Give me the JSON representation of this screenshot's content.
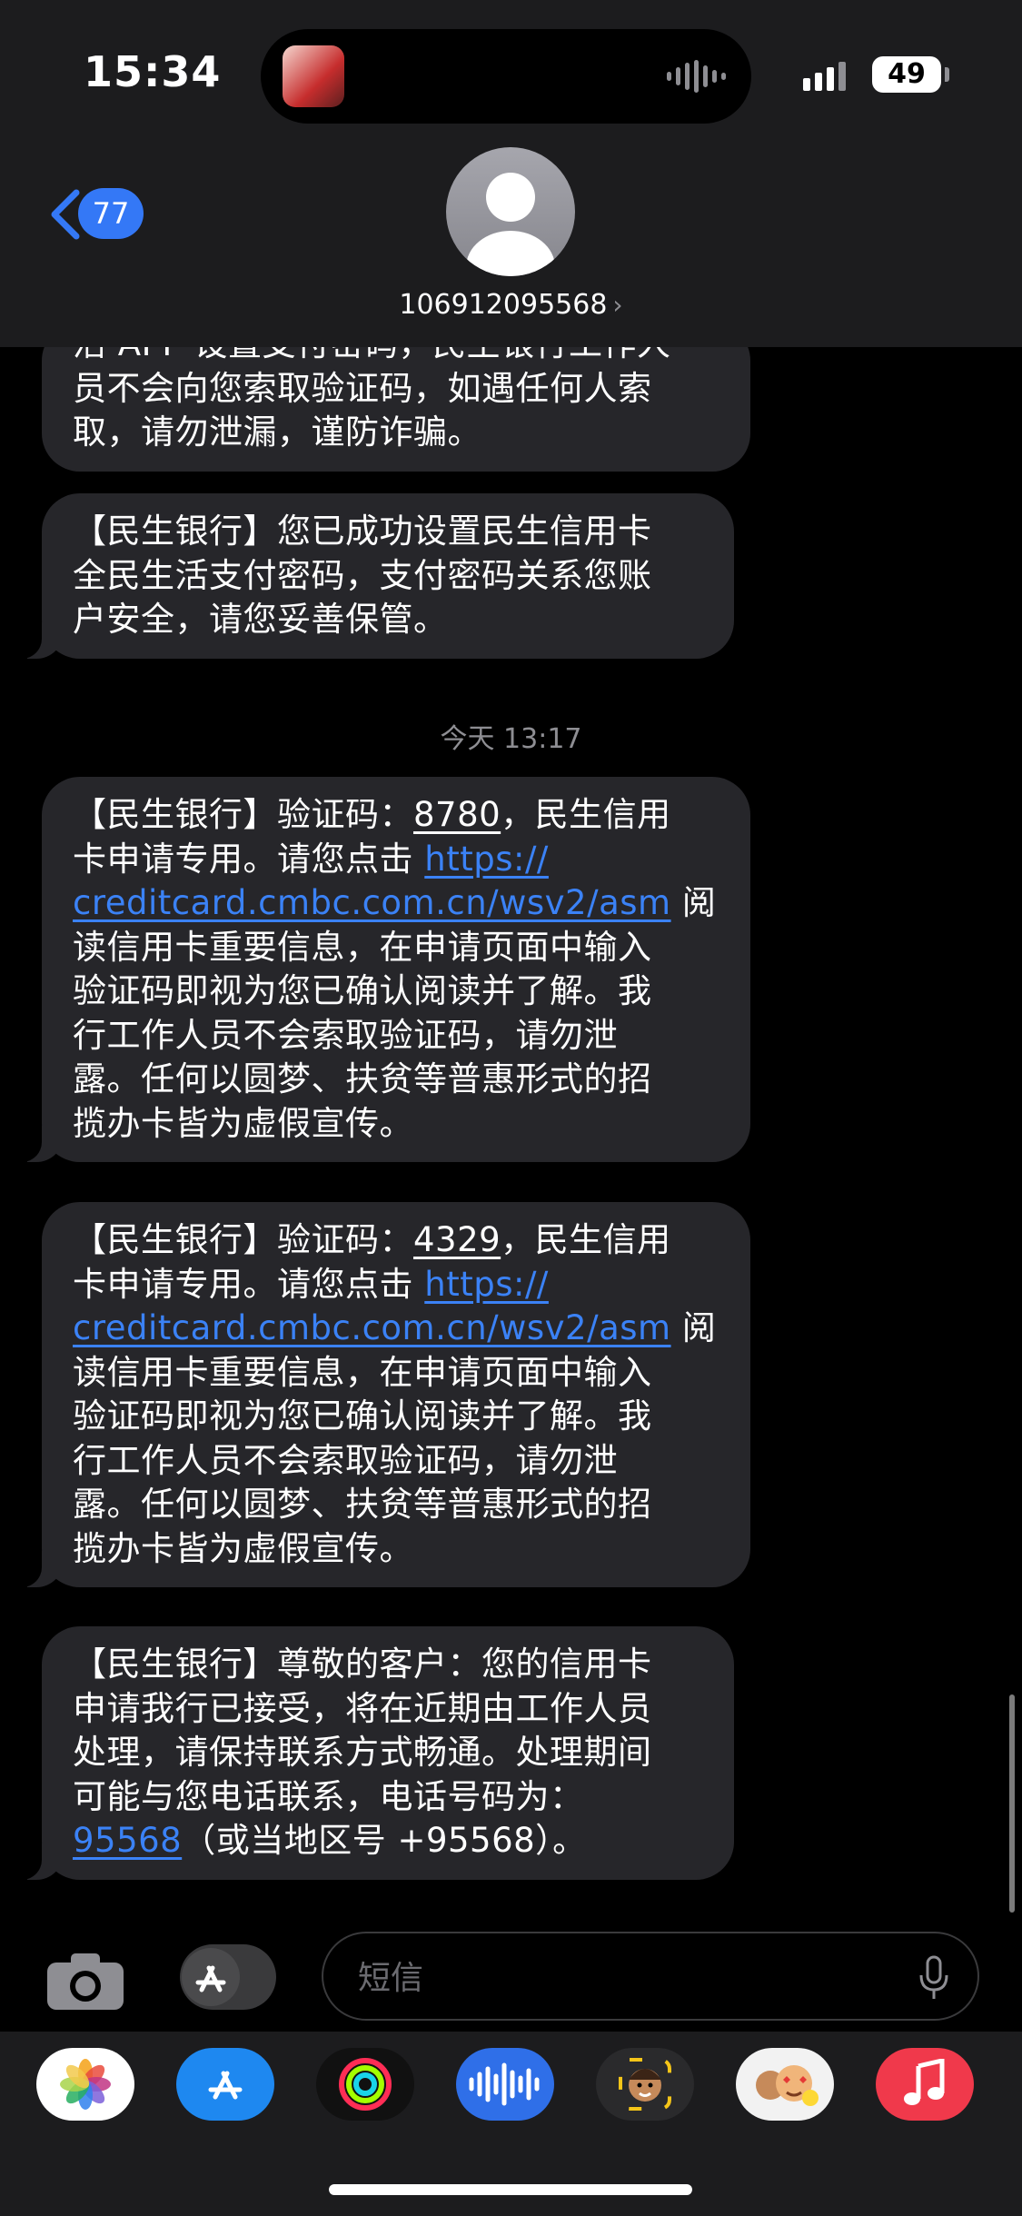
{
  "status": {
    "time": "15:34",
    "battery": "49"
  },
  "header": {
    "back_count": "77",
    "contact_number": "106912095568",
    "contact_chevron": "›"
  },
  "messages": {
    "partial": {
      "lines": [
        "活 APP 设置支付密码，民生银行工作人",
        "员不会向您索取验证码，如遇任何人索",
        "取，请勿泄漏，谨防诈骗。"
      ]
    },
    "m1": {
      "lines": [
        "【民生银行】您已成功设置民生信用卡",
        "全民生活支付密码，支付密码关系您账",
        "户安全，请您妥善保管。"
      ]
    },
    "timestamp": "今天 13:17",
    "m2": {
      "l1_a": "【民生银行】验证码：",
      "code": "8780",
      "l1_b": "，民生信用",
      "l2_a": "卡申请专用。请您点击 ",
      "url_1": "https://",
      "url_2": "creditcard.cmbc.com.cn/wsv2/asm",
      "l3_b": " 阅",
      "rest": [
        "读信用卡重要信息，在申请页面中输入",
        "验证码即视为您已确认阅读并了解。我",
        "行工作人员不会索取验证码，请勿泄",
        "露。任何以圆梦、扶贫等普惠形式的招",
        "揽办卡皆为虚假宣传。"
      ]
    },
    "m3": {
      "l1_a": "【民生银行】验证码：",
      "code": "4329",
      "l1_b": "，民生信用",
      "l2_a": "卡申请专用。请您点击 ",
      "url_1": "https://",
      "url_2": "creditcard.cmbc.com.cn/wsv2/asm",
      "l3_b": " 阅",
      "rest": [
        "读信用卡重要信息，在申请页面中输入",
        "验证码即视为您已确认阅读并了解。我",
        "行工作人员不会索取验证码，请勿泄",
        "露。任何以圆梦、扶贫等普惠形式的招",
        "揽办卡皆为虚假宣传。"
      ]
    },
    "m4": {
      "lines": [
        "【民生银行】尊敬的客户：您的信用卡",
        "申请我行已接受，将在近期由工作人员",
        "处理，请保持联系方式畅通。处理期间",
        "可能与您电话联系，电话号码为："
      ],
      "phone": "95568",
      "tail": "（或当地区号 +95568）。"
    }
  },
  "compose": {
    "placeholder": "短信"
  },
  "apps": [
    "photos-icon",
    "app-store-icon",
    "fitness-icon",
    "audio-message-icon",
    "memoji-icon",
    "animoji-stickers-icon",
    "music-icon"
  ],
  "colors": {
    "link": "#3b82f6",
    "bubble": "#26262a",
    "accent": "#3478f6"
  }
}
